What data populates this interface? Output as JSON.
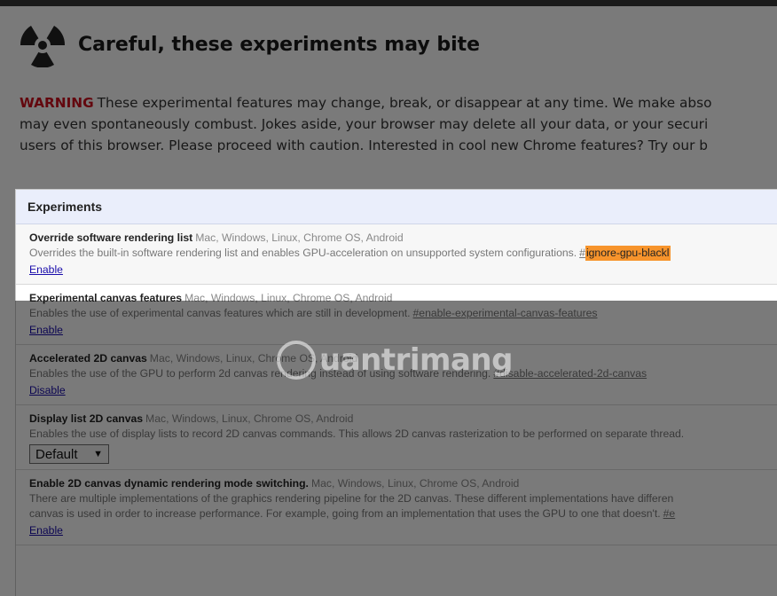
{
  "header": {
    "title": "Careful, these experiments may bite"
  },
  "warning": {
    "label": "WARNING",
    "line1": "These experimental features may change, break, or disappear at any time. We make abso",
    "line2": "may even spontaneously combust. Jokes aside, your browser may delete all your data, or your securi",
    "line3": "users of this browser. Please proceed with caution. Interested in cool new Chrome features? Try our b"
  },
  "experiments": {
    "header": "Experiments",
    "items": [
      {
        "name": "Override software rendering list",
        "platforms": "Mac, Windows, Linux, Chrome OS, Android",
        "description": "Overrides the built-in software rendering list and enables GPU-acceleration on unsupported system configurations.",
        "hash_prefix": "#",
        "hash": "ignore-gpu-blackl",
        "action": "Enable"
      },
      {
        "name": "Experimental canvas features",
        "platforms": "Mac, Windows, Linux, Chrome OS, Android",
        "description": "Enables the use of experimental canvas features which are still in development.",
        "hash": "#enable-experimental-canvas-features",
        "action": "Enable"
      },
      {
        "name": "Accelerated 2D canvas",
        "platforms": "Mac, Windows, Linux, Chrome OS, Android",
        "description": "Enables the use of the GPU to perform 2d canvas rendering instead of using software rendering.",
        "hash": "#disable-accelerated-2d-canvas",
        "action": "Disable"
      },
      {
        "name": "Display list 2D canvas",
        "platforms": "Mac, Windows, Linux, Chrome OS, Android",
        "description": "Enables the use of display lists to record 2D canvas commands. This allows 2D canvas rasterization to be performed on separate thread.",
        "select_value": "Default"
      },
      {
        "name": "Enable 2D canvas dynamic rendering mode switching.",
        "platforms": "Mac, Windows, Linux, Chrome OS, Android",
        "description_line1": "There are multiple implementations of the graphics rendering pipeline for the 2D canvas. These different implementations have differen",
        "description_line2": "canvas is used in order to increase performance. For example, going from an implementation that uses the GPU to one that doesn't.",
        "hash": "#e",
        "action": "Enable"
      }
    ]
  },
  "watermark": {
    "text": "uantrimang"
  },
  "colors": {
    "warning": "#d0101f",
    "link": "#1a0dab",
    "hash_highlight": "#f7942c",
    "panel_header": "#eaeefb"
  }
}
